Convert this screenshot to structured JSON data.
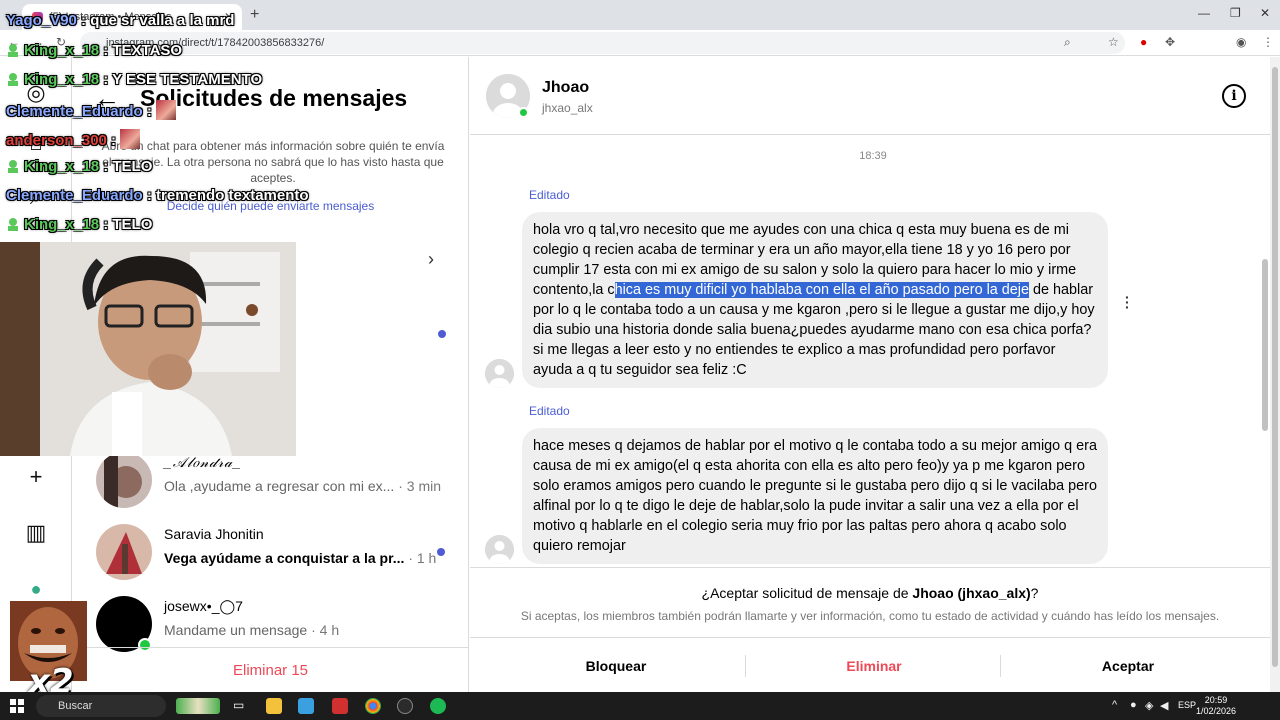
{
  "browser": {
    "tab_title": "(5) Instagram • Mensajes",
    "url": "instagram.com/direct/t/17842003856833276/"
  },
  "requests": {
    "title": "Solicitudes de mensajes",
    "info": "Abre un chat para obtener más información sobre quién te envía el mensaje. La otra persona no sabrá que lo has visto hasta que aceptes.",
    "decide_link": "Decide quién puede enviarte mensajes",
    "items": [
      {
        "name": "_𝒜𝓁𝑜𝓃𝒹𝓇𝒶_",
        "preview": "Ola ,ayudame a regresar con mi ex...",
        "time": " · 3 min",
        "unread": false
      },
      {
        "name": "Saravia Jhonitin",
        "preview": "Vega ayúdame a conquistar a la pr...",
        "time": " · 1 h",
        "unread": true
      },
      {
        "name": "josewx•_◯7",
        "preview": "Mandame un mensage",
        "time": " · 4 h",
        "unread": false
      }
    ],
    "delete_all": "Eliminar 15"
  },
  "chat": {
    "name": "Jhoao",
    "handle": "jhxao_alx",
    "timestamp": "18:39",
    "edited_label": "Editado",
    "messages": [
      {
        "before": "hola vro q tal,vro necesito que me ayudes con una chica q esta muy buena es de mi colegio q recien acaba de terminar  y era un año mayor,ella tiene 18 y yo 16 pero por cumplir 17 esta con mi ex amigo de su salon y solo la quiero para hacer lo mio y irme contento,la c",
        "highlight": "hica es muy dificil  yo hablaba con ella el año pasado pero la deje",
        "after": " de hablar por lo q le contaba todo a un causa y me kgaron ,pero si le llegue a gustar me dijo,y hoy dia subio una historia donde salia buena¿puedes ayudarme mano con esa chica porfa?si me llegas a leer esto y no entiendes te explico a mas profundidad pero porfavor ayuda a q tu seguidor sea feliz :C"
      },
      {
        "text": "hace meses q dejamos de hablar por el motivo q le contaba todo a su mejor amigo q era causa de mi ex amigo(el q esta ahorita con ella es alto pero feo)y ya p me kgaron pero solo eramos amigos pero cuando le pregunte si le gustaba pero dijo q si le vacilaba pero alfinal por lo q te digo le deje de hablar,solo la pude invitar a salir una vez a ella por el motivo q hablarle en el colegio seria muy frio por las paltas pero ahora q acabo solo quiero remojar"
      }
    ],
    "accept_prefix": "¿Aceptar solicitud de mensaje de ",
    "accept_name": "Jhoao (jhxao_alx)",
    "accept_suffix": "?",
    "accept_note": "Si aceptas, los miembros también podrán llamarte y ver información, como tu estado de actividad y cuándo has leído los mensajes.",
    "actions": {
      "block": "Bloquear",
      "delete": "Eliminar",
      "accept": "Aceptar"
    }
  },
  "overlay_chat": [
    {
      "user": "Yago_V90",
      "msg": " : que sr valla a la mrd",
      "color": "blue"
    },
    {
      "user": "King_x_18",
      "msg": " : TEXTASO",
      "color": "green"
    },
    {
      "user": "King_x_18",
      "msg": " : Y ESE TESTAMENTO",
      "color": "green"
    },
    {
      "user": "Clemente_Eduardo",
      "msg": " : ",
      "color": "blue"
    },
    {
      "user": "anderson_300",
      "msg": " : ",
      "color": "red"
    },
    {
      "user": "King_x_18",
      "msg": " : TELO",
      "color": "green"
    },
    {
      "user": "Clemente_Eduardo",
      "msg": " : tremendo textamento",
      "color": "blue"
    },
    {
      "user": "King_x_18",
      "msg": " : TELO",
      "color": "green"
    }
  ],
  "overlay_multiplier": "x2",
  "taskbar": {
    "search": "Buscar",
    "lang": "ESP",
    "time": "20:59",
    "date": "1/02/2026"
  },
  "colors": {
    "link_blue": "#4a5dd1",
    "danger_red": "#ed4956",
    "online_green": "#20c840",
    "highlight_blue": "#3367d6"
  }
}
